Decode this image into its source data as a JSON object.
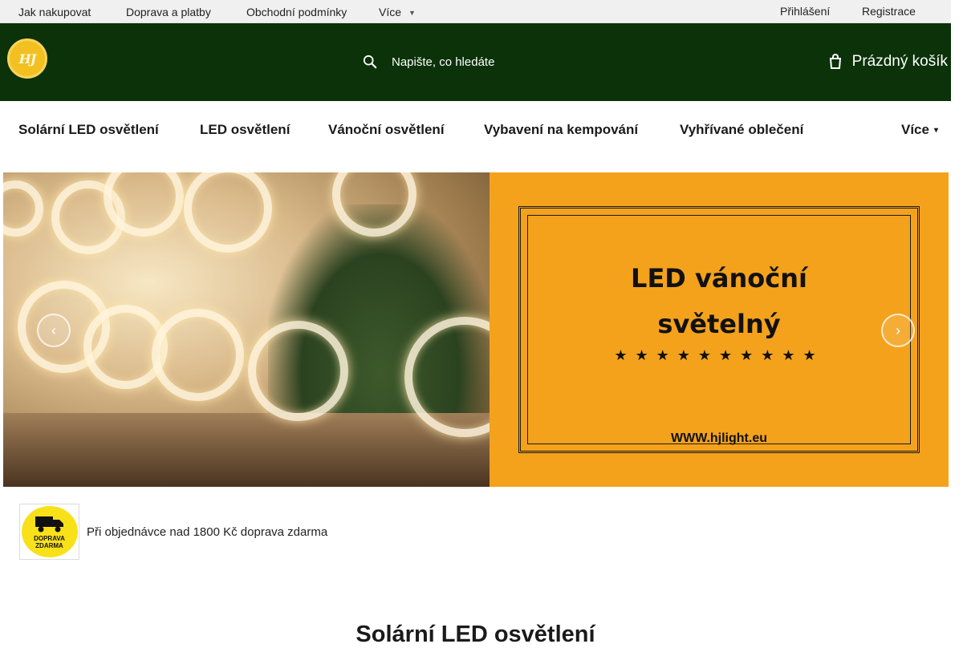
{
  "topbar": {
    "links": [
      "Jak nakupovat",
      "Doprava a platby",
      "Obchodní podmínky"
    ],
    "more_label": "Více",
    "login_label": "Přihlášení",
    "register_label": "Registrace"
  },
  "header": {
    "logo_text": "HJ",
    "search_placeholder": "Napište, co hledáte",
    "cart_label": "Prázdný košík"
  },
  "categories": {
    "items": [
      "Solární LED osvětlení",
      "LED osvětlení",
      "Vánoční osvětlení",
      "Vybavení na kempování",
      "Vyhřívané oblečení"
    ],
    "more_label": "Více"
  },
  "banner": {
    "title_line1": "LED vánoční",
    "title_line2": "světelný",
    "stars": "★★★★★★★★★★",
    "url": "WWW.hjlight.eu"
  },
  "promo": {
    "badge_line1": "DOPRAVA",
    "badge_line2": "ZDARMA",
    "text": "Při objednávce nad 1800 Kč doprava zdarma"
  },
  "section": {
    "title": "Solární LED osvětlení"
  },
  "colors": {
    "header_bg": "#0b3209",
    "topbar_bg": "#f0f0f0",
    "banner_right_bg": "#f4a21c",
    "badge_yellow": "#f9e11a"
  }
}
